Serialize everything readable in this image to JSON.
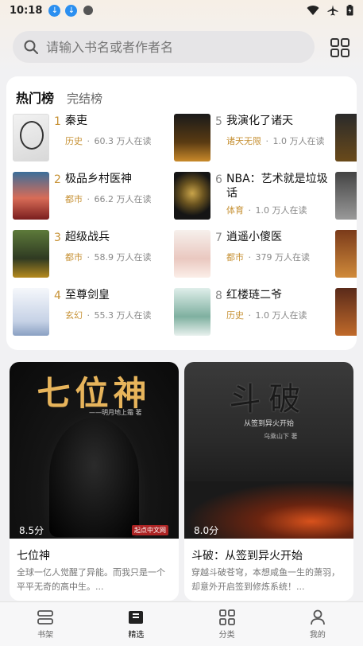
{
  "status_bar": {
    "time": "10:18"
  },
  "search": {
    "placeholder": "请输入书名或者作者名"
  },
  "ranking": {
    "tabs": [
      {
        "label": "热门榜",
        "active": true
      },
      {
        "label": "完结榜",
        "active": false
      }
    ],
    "items": [
      {
        "rank": "1",
        "title": "秦吏",
        "genre": "历史",
        "readers": "60.3 万人在读"
      },
      {
        "rank": "2",
        "title": "极品乡村医神",
        "genre": "都市",
        "readers": "66.2 万人在读"
      },
      {
        "rank": "3",
        "title": "超级战兵",
        "genre": "都市",
        "readers": "58.9 万人在读"
      },
      {
        "rank": "4",
        "title": "至尊剑皇",
        "genre": "玄幻",
        "readers": "55.3 万人在读"
      },
      {
        "rank": "5",
        "title": "我演化了诸天",
        "genre": "诸天无限",
        "readers": "1.0 万人在读"
      },
      {
        "rank": "6",
        "title": "NBA：艺术就是垃圾话",
        "genre": "体育",
        "readers": "1.0 万人在读"
      },
      {
        "rank": "7",
        "title": "逍遥小傻医",
        "genre": "都市",
        "readers": "379 万人在读"
      },
      {
        "rank": "8",
        "title": "红楼琏二爷",
        "genre": "历史",
        "readers": "1.0 万人在读"
      }
    ]
  },
  "featured": [
    {
      "cover_title": "七位神",
      "cover_author": "——明月地上霜 著",
      "cover_badge": "起点中文网",
      "score": "8.5分",
      "title": "七位神",
      "desc": "全球一亿人觉醒了异能。而我只是一个平平无奇的高中生。..."
    },
    {
      "cover_title": "斗破",
      "cover_subtitle": "从签到异火开始",
      "cover_author": "乌乘山下 著",
      "score": "8.0分",
      "title": "斗破：从签到异火开始",
      "desc": "穿越斗破苍穹，本想咸鱼一生的萧羽，却意外开启签到修炼系统！..."
    }
  ],
  "bottom_nav": [
    {
      "label": "书架",
      "icon": "bookshelf-icon"
    },
    {
      "label": "精选",
      "icon": "featured-book-icon",
      "active": true
    },
    {
      "label": "分类",
      "icon": "category-grid-icon"
    },
    {
      "label": "我的",
      "icon": "profile-icon"
    }
  ],
  "colors": {
    "accent": "#c79236",
    "background": "#f1f1f3",
    "card": "#ffffff"
  }
}
